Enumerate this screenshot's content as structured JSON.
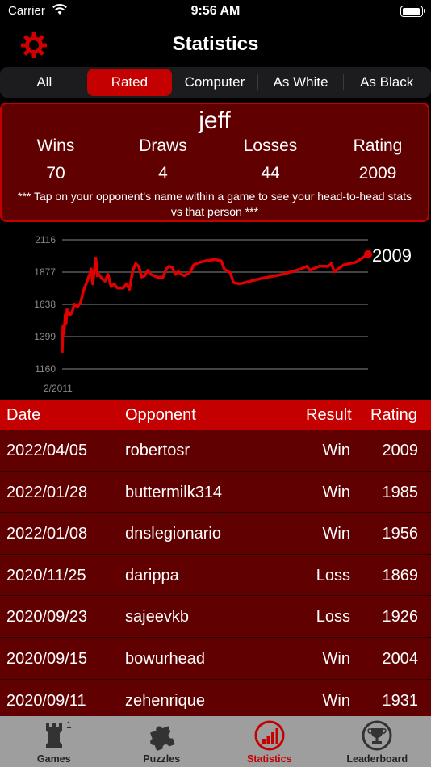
{
  "status": {
    "carrier": "Carrier",
    "time": "9:56 AM"
  },
  "nav": {
    "title": "Statistics"
  },
  "segments": [
    {
      "label": "All",
      "active": false
    },
    {
      "label": "Rated",
      "active": true
    },
    {
      "label": "Computer",
      "active": false
    },
    {
      "label": "As White",
      "active": false
    },
    {
      "label": "As Black",
      "active": false
    }
  ],
  "summary": {
    "player": "jeff",
    "wins_label": "Wins",
    "wins": "70",
    "draws_label": "Draws",
    "draws": "4",
    "losses_label": "Losses",
    "losses": "44",
    "rating_label": "Rating",
    "rating": "2009",
    "tip": "*** Tap on your opponent's name within a game to see your head-to-head stats vs that person ***"
  },
  "chart_data": {
    "type": "line",
    "y_ticks": [
      "2116",
      "1877",
      "1638",
      "1399",
      "1160"
    ],
    "ylim": [
      1160,
      2116
    ],
    "x_start_label": "2/2011",
    "current_label": "2009",
    "series": [
      {
        "color": "#e00000",
        "points": [
          [
            0,
            1280
          ],
          [
            0.3,
            1480
          ],
          [
            0.6,
            1420
          ],
          [
            1,
            1560
          ],
          [
            1.3,
            1500
          ],
          [
            1.6,
            1600
          ],
          [
            2,
            1580
          ],
          [
            2.5,
            1560
          ],
          [
            3,
            1570
          ],
          [
            3.5,
            1600
          ],
          [
            4,
            1640
          ],
          [
            5,
            1620
          ],
          [
            6,
            1650
          ],
          [
            7,
            1740
          ],
          [
            8,
            1800
          ],
          [
            9,
            1860
          ],
          [
            9.5,
            1900
          ],
          [
            10,
            1790
          ],
          [
            11,
            1980
          ],
          [
            11.5,
            1850
          ],
          [
            12,
            1860
          ],
          [
            13,
            1830
          ],
          [
            14,
            1810
          ],
          [
            15,
            1860
          ],
          [
            16,
            1770
          ],
          [
            17,
            1790
          ],
          [
            18,
            1760
          ],
          [
            20,
            1760
          ],
          [
            21,
            1790
          ],
          [
            22,
            1750
          ],
          [
            23,
            1880
          ],
          [
            24,
            1940
          ],
          [
            25,
            1920
          ],
          [
            26,
            1840
          ],
          [
            27,
            1850
          ],
          [
            28,
            1890
          ],
          [
            29,
            1860
          ],
          [
            30,
            1850
          ],
          [
            31,
            1840
          ],
          [
            33,
            1840
          ],
          [
            34,
            1900
          ],
          [
            35,
            1920
          ],
          [
            36,
            1910
          ],
          [
            37,
            1860
          ],
          [
            38,
            1880
          ],
          [
            39,
            1860
          ],
          [
            40,
            1850
          ],
          [
            42,
            1880
          ],
          [
            43,
            1930
          ],
          [
            45,
            1950
          ],
          [
            47,
            1960
          ],
          [
            50,
            1970
          ],
          [
            52,
            1960
          ],
          [
            53,
            1900
          ],
          [
            55,
            1870
          ],
          [
            56,
            1800
          ],
          [
            58,
            1790
          ],
          [
            65,
            1830
          ],
          [
            72,
            1860
          ],
          [
            78,
            1900
          ],
          [
            80,
            1920
          ],
          [
            81,
            1890
          ],
          [
            84,
            1920
          ],
          [
            87,
            1920
          ],
          [
            88,
            1940
          ],
          [
            89,
            1880
          ],
          [
            92,
            1930
          ],
          [
            96,
            1950
          ],
          [
            100,
            2009
          ]
        ]
      }
    ]
  },
  "table": {
    "headers": {
      "date": "Date",
      "opponent": "Opponent",
      "result": "Result",
      "rating": "Rating"
    },
    "rows": [
      {
        "date": "2022/04/05",
        "opponent": "robertosr",
        "result": "Win",
        "rating": "2009"
      },
      {
        "date": "2022/01/28",
        "opponent": "buttermilk314",
        "result": "Win",
        "rating": "1985"
      },
      {
        "date": "2022/01/08",
        "opponent": "dnslegionario",
        "result": "Win",
        "rating": "1956"
      },
      {
        "date": "2020/11/25",
        "opponent": "darippa",
        "result": "Loss",
        "rating": "1869"
      },
      {
        "date": "2020/09/23",
        "opponent": "sajeevkb",
        "result": "Loss",
        "rating": "1926"
      },
      {
        "date": "2020/09/15",
        "opponent": "bowurhead",
        "result": "Win",
        "rating": "2004"
      },
      {
        "date": "2020/09/11",
        "opponent": "zehenrique",
        "result": "Win",
        "rating": "1931"
      }
    ]
  },
  "tabs": [
    {
      "label": "Games",
      "icon": "rook-icon",
      "badge": "1",
      "active": false
    },
    {
      "label": "Puzzles",
      "icon": "puzzle-icon",
      "active": false
    },
    {
      "label": "Statistics",
      "icon": "stats-chart-icon",
      "active": true
    },
    {
      "label": "Leaderboard",
      "icon": "trophy-icon",
      "active": false
    }
  ],
  "colors": {
    "accent": "#c40000",
    "card_bg": "#600000",
    "tabbar_bg": "#9e9e9e"
  }
}
